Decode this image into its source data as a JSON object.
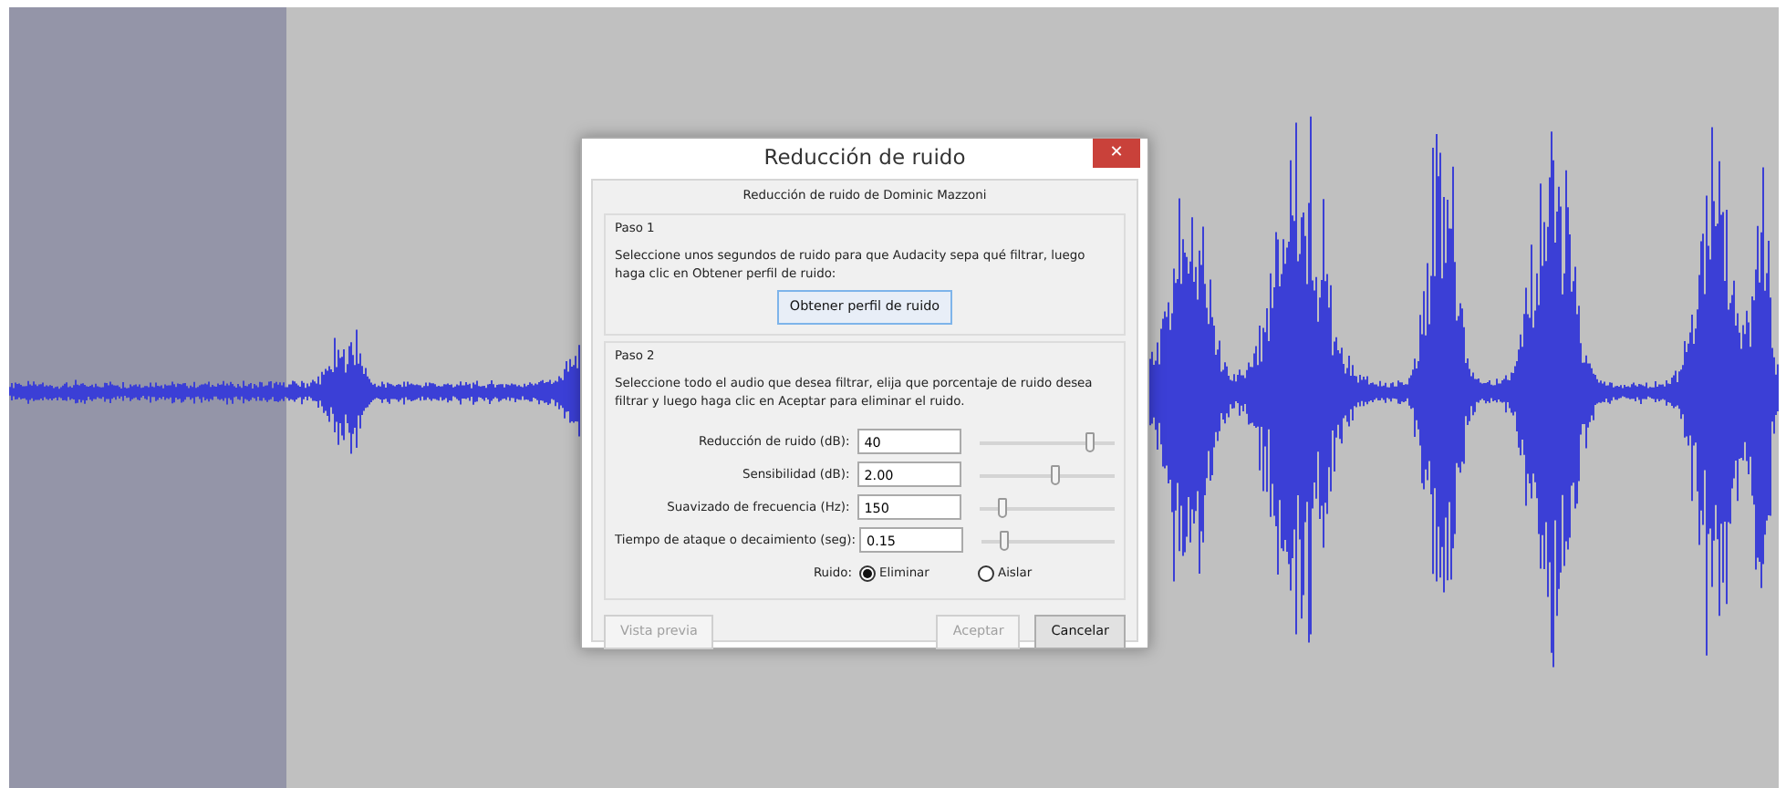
{
  "window": {
    "title": "Reducción de ruido",
    "close_label": "✕"
  },
  "dialog": {
    "heading": "Reducción de ruido de Dominic Mazzoni",
    "step1": {
      "title": "Paso 1",
      "text": "Seleccione unos segundos de ruido para que Audacity sepa qué filtrar, luego haga clic en Obtener perfil de ruido:",
      "button": "Obtener perfil de ruido"
    },
    "step2": {
      "title": "Paso 2",
      "text": "Seleccione todo el audio que desea filtrar, elija que porcentaje de ruido desea filtrar y luego haga clic en Aceptar para eliminar el ruido.",
      "settings": [
        {
          "label": "Reducción de ruido (dB):",
          "value": "40",
          "level": 0.81
        },
        {
          "label": "Sensibilidad (dB):",
          "value": "2.00",
          "level": 0.55
        },
        {
          "label": "Suavizado de frecuencia (Hz):",
          "value": "150",
          "level": 0.17
        },
        {
          "label": "Tiempo de ataque o decaimiento (seg):",
          "value": "0.15",
          "level": 0.17
        }
      ],
      "noise": {
        "label": "Ruido:",
        "options": [
          {
            "label": "Eliminar",
            "selected": true
          },
          {
            "label": "Aislar",
            "selected": false
          }
        ]
      }
    },
    "buttons": [
      {
        "label": "Vista previa",
        "disabled": true
      },
      {
        "label": "Aceptar",
        "disabled": true
      },
      {
        "label": "Cancelar",
        "disabled": false
      }
    ]
  }
}
